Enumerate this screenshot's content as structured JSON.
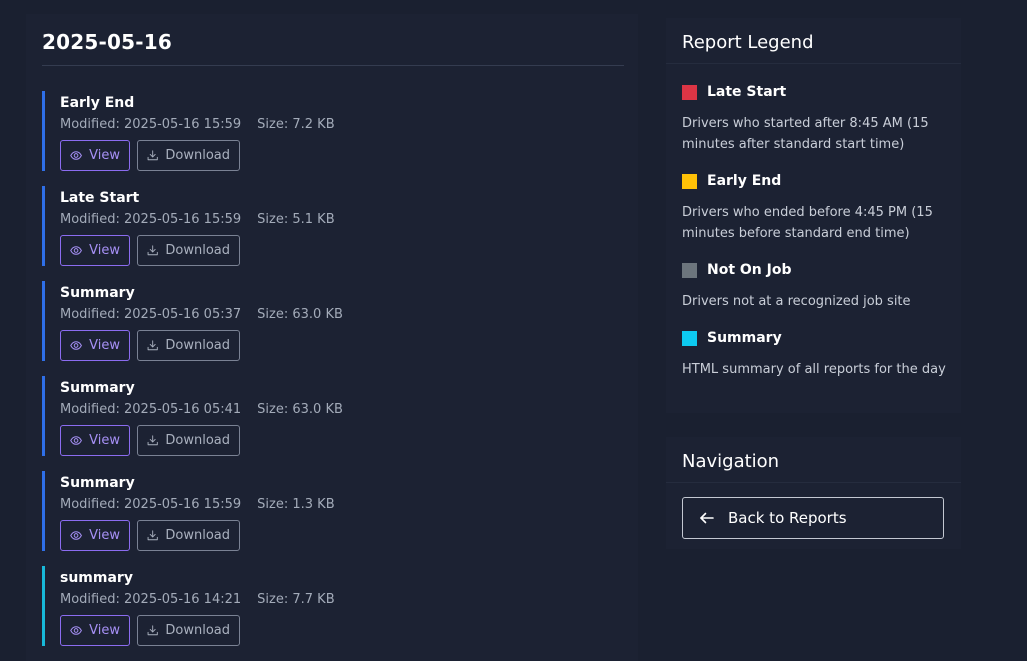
{
  "date_heading": "2025-05-16",
  "labels": {
    "modified_prefix": "Modified:",
    "size_prefix": "Size:",
    "view_button": "View",
    "download_button": "Download"
  },
  "reports": [
    {
      "title": "Early End",
      "modified": "2025-05-16 15:59",
      "size": "7.2 KB",
      "accent": "#2f6fe8"
    },
    {
      "title": "Late Start",
      "modified": "2025-05-16 15:59",
      "size": "5.1 KB",
      "accent": "#2f6fe8"
    },
    {
      "title": "Summary",
      "modified": "2025-05-16 05:37",
      "size": "63.0 KB",
      "accent": "#2f6fe8"
    },
    {
      "title": "Summary",
      "modified": "2025-05-16 05:41",
      "size": "63.0 KB",
      "accent": "#2f6fe8"
    },
    {
      "title": "Summary",
      "modified": "2025-05-16 15:59",
      "size": "1.3 KB",
      "accent": "#2f6fe8"
    },
    {
      "title": "summary",
      "modified": "2025-05-16 14:21",
      "size": "7.7 KB",
      "accent": "#18b9d9"
    }
  ],
  "legend": {
    "title": "Report Legend",
    "items": [
      {
        "label": "Late Start",
        "color": "#dc3545",
        "description": "Drivers who started after 8:45 AM (15 minutes after standard start time)"
      },
      {
        "label": "Early End",
        "color": "#ffc107",
        "description": "Drivers who ended before 4:45 PM (15 minutes before standard end time)"
      },
      {
        "label": "Not On Job",
        "color": "#6c757d",
        "description": "Drivers not at a recognized job site"
      },
      {
        "label": "Summary",
        "color": "#0dcaf0",
        "description": "HTML summary of all reports for the day"
      }
    ]
  },
  "navigation": {
    "title": "Navigation",
    "back_button": "Back to Reports",
    "back_icon": "arrow-left-icon"
  },
  "icons": {
    "view": "eye-icon",
    "download": "download-icon"
  }
}
